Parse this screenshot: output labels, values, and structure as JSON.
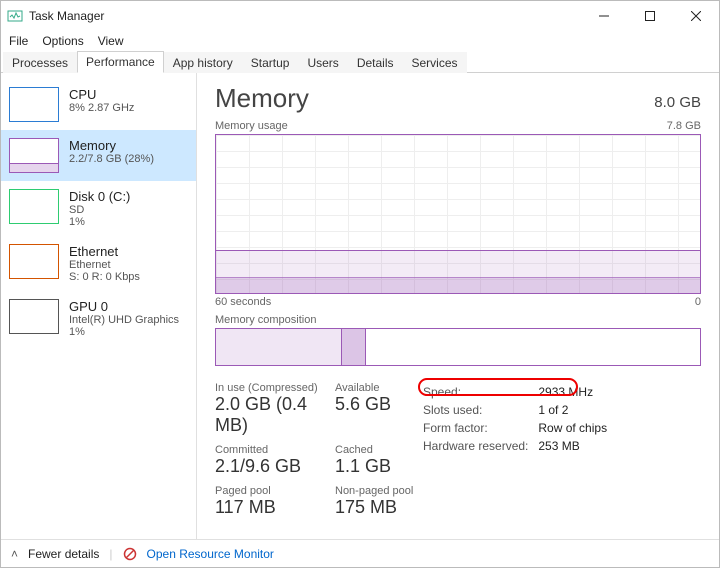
{
  "window": {
    "title": "Task Manager"
  },
  "menu": {
    "file": "File",
    "options": "Options",
    "view": "View"
  },
  "tabs": {
    "processes": "Processes",
    "performance": "Performance",
    "appHistory": "App history",
    "startup": "Startup",
    "users": "Users",
    "details": "Details",
    "services": "Services"
  },
  "sidebar": {
    "cpu": {
      "title": "CPU",
      "sub": "8%  2.87 GHz"
    },
    "mem": {
      "title": "Memory",
      "sub": "2.2/7.8 GB (28%)"
    },
    "disk": {
      "title": "Disk 0 (C:)",
      "sub": "SD",
      "sub2": "1%"
    },
    "eth": {
      "title": "Ethernet",
      "sub": "Ethernet",
      "sub2": "S: 0  R: 0 Kbps"
    },
    "gpu": {
      "title": "GPU 0",
      "sub": "Intel(R) UHD Graphics",
      "sub2": "1%"
    }
  },
  "main": {
    "title": "Memory",
    "capacity": "8.0 GB",
    "usageLabel": "Memory usage",
    "usageMax": "7.8 GB",
    "axisLeft": "60 seconds",
    "axisRight": "0",
    "compLabel": "Memory composition",
    "stats": {
      "inUseLabel": "In use (Compressed)",
      "inUseValue": "2.0 GB (0.4 MB)",
      "availLabel": "Available",
      "availValue": "5.6 GB",
      "commLabel": "Committed",
      "commValue": "2.1/9.6 GB",
      "cachedLabel": "Cached",
      "cachedValue": "1.1 GB",
      "pagedLabel": "Paged pool",
      "pagedValue": "117 MB",
      "npagedLabel": "Non-paged pool",
      "npagedValue": "175 MB"
    },
    "right": {
      "speedLabel": "Speed:",
      "speedValue": "2933 MHz",
      "slotsLabel": "Slots used:",
      "slotsValue": "1 of 2",
      "formLabel": "Form factor:",
      "formValue": "Row of chips",
      "hwresLabel": "Hardware reserved:",
      "hwresValue": "253 MB"
    }
  },
  "footer": {
    "fewer": "Fewer details",
    "openRM": "Open Resource Monitor"
  }
}
